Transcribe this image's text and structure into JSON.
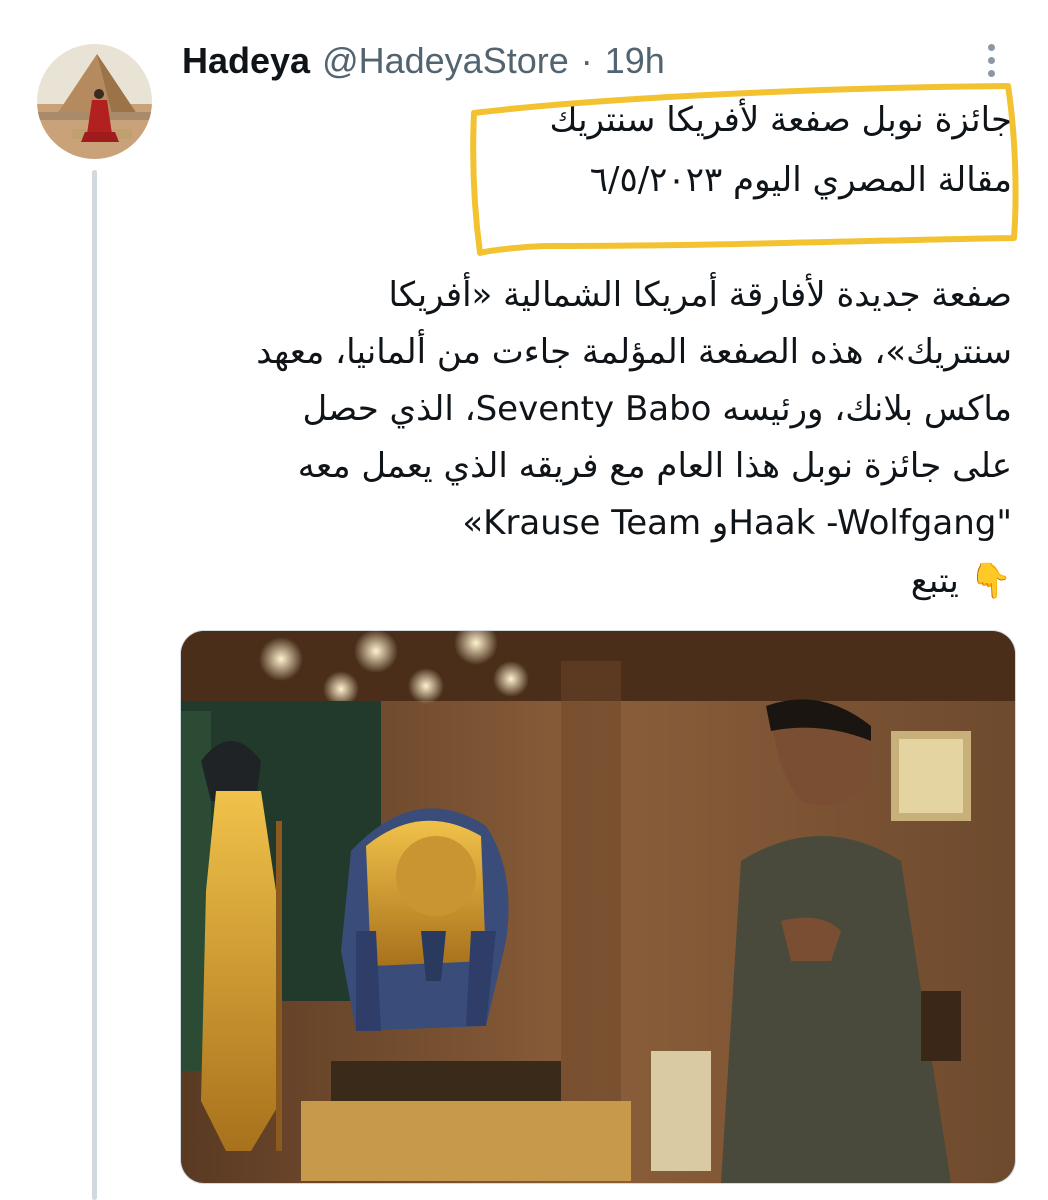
{
  "tweet": {
    "author": {
      "display_name": "Hadeya",
      "handle": "@HadeyaStore",
      "separator": "·",
      "time": "19h"
    },
    "text_lines": [
      "جائزة نوبل صفعة لأفريكا سنتريك",
      "مقالة المصري اليوم ٦/٥/٢٠٢٣",
      "",
      "صفعة جديدة لأفارقة أمريكا الشمالية «أفريكا",
      "سنتريك»، هذه الصفعة المؤلمة جاءت من ألمانيا، معهد",
      "ماكس بلانك، ورئيسه Seventy Babo، الذي حصل",
      "على جائزة نوبل هذا العام مع فريقه الذي يعمل معه",
      "«Krause Team وHaak -Wolfgang\"",
      "👇 يتبع"
    ],
    "media_alt": "Museum photo: young man in a galabeya viewing the golden mask of Tutankhamun in a glass display case",
    "icons": {
      "more": "more-icon",
      "pointing_down": "pointing-down-emoji"
    },
    "colors": {
      "highlight": "#f2c230",
      "thread_line": "#cfd9de",
      "meta_text": "#536471"
    }
  }
}
